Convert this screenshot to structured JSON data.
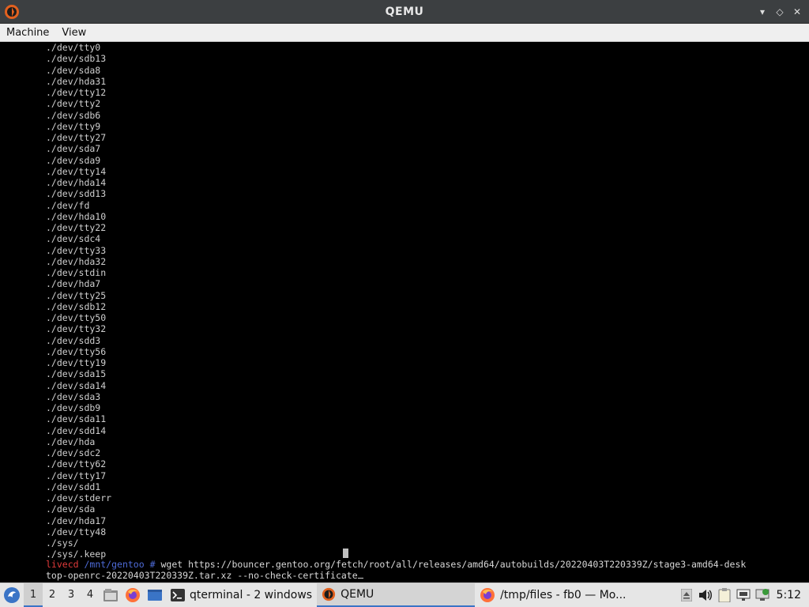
{
  "window": {
    "title": "QEMU",
    "minimize_glyph": "▾",
    "restore_glyph": "◇",
    "close_glyph": "✕"
  },
  "menu": [
    "Machine",
    "View"
  ],
  "terminal": {
    "lines": [
      "./dev/tty0",
      "./dev/sdb13",
      "./dev/sda8",
      "./dev/hda31",
      "./dev/tty12",
      "./dev/tty2",
      "./dev/sdb6",
      "./dev/tty9",
      "./dev/tty27",
      "./dev/sda7",
      "./dev/sda9",
      "./dev/tty14",
      "./dev/hda14",
      "./dev/sdd13",
      "./dev/fd",
      "./dev/hda10",
      "./dev/tty22",
      "./dev/sdc4",
      "./dev/tty33",
      "./dev/hda32",
      "./dev/stdin",
      "./dev/hda7",
      "./dev/tty25",
      "./dev/sdb12",
      "./dev/tty50",
      "./dev/tty32",
      "./dev/sdd3",
      "./dev/tty56",
      "./dev/tty19",
      "./dev/sda15",
      "./dev/sda14",
      "./dev/sda3",
      "./dev/sdb9",
      "./dev/sda11",
      "./dev/sdd14",
      "./dev/hda",
      "./dev/sdc2",
      "./dev/tty62",
      "./dev/tty17",
      "./dev/sdd1",
      "./dev/stderr",
      "./dev/sda",
      "./dev/hda17",
      "./dev/tty48",
      "./sys/",
      "./sys/.keep"
    ],
    "prompt": {
      "host": "livecd",
      "path": "/mnt/gentoo",
      "symbol": "#",
      "command": "wget https://bouncer.gentoo.org/fetch/root/all/releases/amd64/autobuilds/20220403T220339Z/stage3-amd64-desk",
      "continuation": "top-openrc-20220403T220339Z.tar.xz --no-check-certificate"
    }
  },
  "taskbar": {
    "workspaces": [
      "1",
      "2",
      "3",
      "4"
    ],
    "active_workspace": "1",
    "quicklaunch": [
      "file-manager-icon",
      "firefox-icon",
      "show-desktop-icon"
    ],
    "tasks": [
      {
        "label": "qterminal - 2 windows",
        "icon": "terminal-icon",
        "active": false
      },
      {
        "label": "QEMU",
        "icon": "qemu-icon",
        "active": true
      },
      {
        "label": "/tmp/files - fb0 — Mo...",
        "icon": "firefox-icon",
        "active": false
      }
    ],
    "tray": [
      "eject-icon",
      "volume-icon",
      "clipboard-icon",
      "network-icon",
      "update-icon"
    ],
    "clock": "5:12"
  },
  "colors": {
    "titlebar": "#3c3f41",
    "menubar": "#efefef",
    "terminal_bg": "#000000",
    "prompt_host": "#e23b3b",
    "prompt_path": "#4e6bd8",
    "taskbar": "#e6e6e6",
    "accent": "#3a74c6"
  }
}
